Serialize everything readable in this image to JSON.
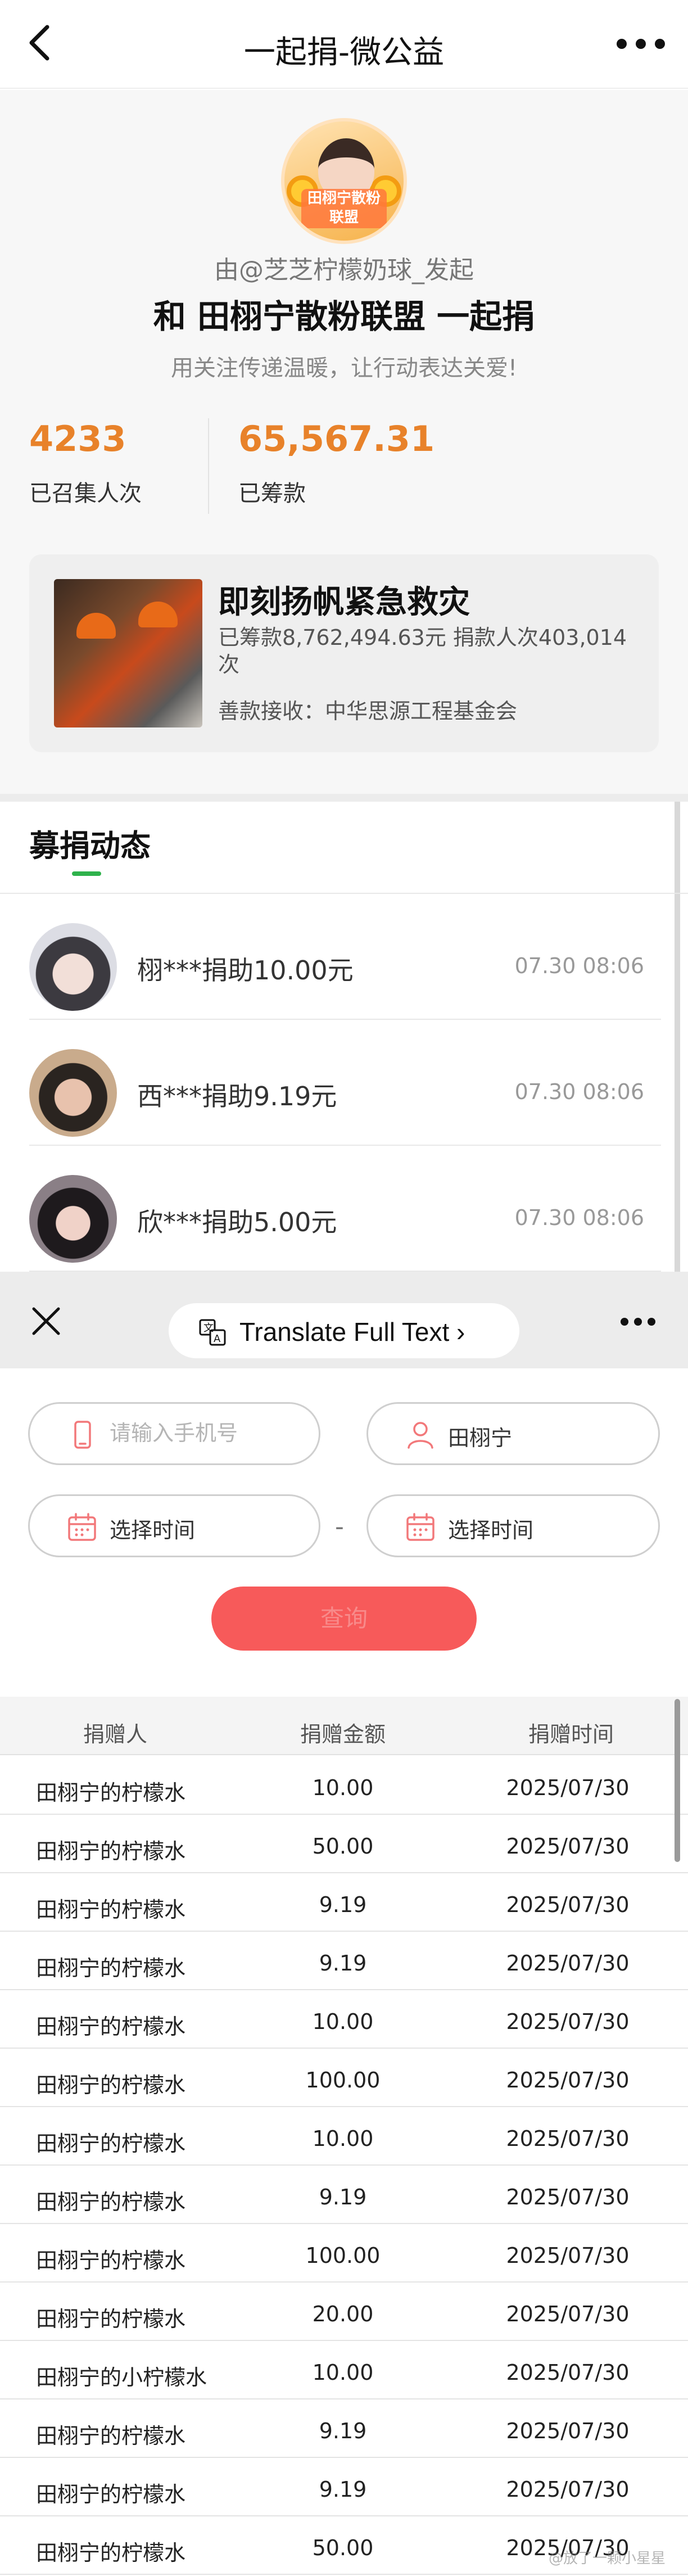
{
  "nav": {
    "title": "一起捐-微公益",
    "back_icon": "chevron-left-icon",
    "more_icon": "more-dots-icon"
  },
  "campaign": {
    "avatar_label": "田栩宁散粉联盟",
    "initiator": "由@芝芝柠檬奶球_发起",
    "title": "和 田栩宁散粉联盟 一起捐",
    "slogan": "用关注传递温暖，让行动表达关爱!",
    "stats": [
      {
        "value": "4233",
        "label": "已召集人次"
      },
      {
        "value": "65,567.31",
        "label": "已筹款"
      }
    ],
    "project": {
      "name": "即刻扬帆紧急救灾",
      "stats": "已筹款8,762,494.63元  捐款人次403,014次",
      "receiver": "善款接收：中华思源工程基金会"
    }
  },
  "feed": {
    "title": "募捐动态",
    "items": [
      {
        "text": "栩***捐助10.00元",
        "time": "07.30 08:06"
      },
      {
        "text": "西***捐助9.19元",
        "time": "07.30 08:06"
      },
      {
        "text": "欣***捐助5.00元",
        "time": "07.30 08:06"
      }
    ]
  },
  "translate_bar": {
    "label": "Translate Full Text ›",
    "close_icon": "close-icon",
    "translate_icon": "translate-icon",
    "more_icon": "more-dots-icon"
  },
  "search": {
    "phone_placeholder": "请输入手机号",
    "name_value": "田栩宁",
    "start_date_label": "选择时间",
    "end_date_label": "选择时间",
    "separator": "-",
    "query_button": "查询"
  },
  "table": {
    "headers": [
      "捐赠人",
      "捐赠金额",
      "捐赠时间"
    ],
    "rows": [
      [
        "田栩宁的柠檬水",
        "10.00",
        "2025/07/30"
      ],
      [
        "田栩宁的柠檬水",
        "50.00",
        "2025/07/30"
      ],
      [
        "田栩宁的柠檬水",
        "9.19",
        "2025/07/30"
      ],
      [
        "田栩宁的柠檬水",
        "9.19",
        "2025/07/30"
      ],
      [
        "田栩宁的柠檬水",
        "10.00",
        "2025/07/30"
      ],
      [
        "田栩宁的柠檬水",
        "100.00",
        "2025/07/30"
      ],
      [
        "田栩宁的柠檬水",
        "10.00",
        "2025/07/30"
      ],
      [
        "田栩宁的柠檬水",
        "9.19",
        "2025/07/30"
      ],
      [
        "田栩宁的柠檬水",
        "100.00",
        "2025/07/30"
      ],
      [
        "田栩宁的柠檬水",
        "20.00",
        "2025/07/30"
      ],
      [
        "田栩宁的小柠檬水",
        "10.00",
        "2025/07/30"
      ],
      [
        "田栩宁的柠檬水",
        "9.19",
        "2025/07/30"
      ],
      [
        "田栩宁的柠檬水",
        "9.19",
        "2025/07/30"
      ],
      [
        "田栩宁的柠檬水",
        "50.00",
        "2025/07/30"
      ]
    ]
  },
  "watermark": "@放了一颗小星星",
  "colors": {
    "accent_orange": "#e8822a",
    "query_red": "#f75a5a",
    "tab_green": "#2fb24c"
  }
}
